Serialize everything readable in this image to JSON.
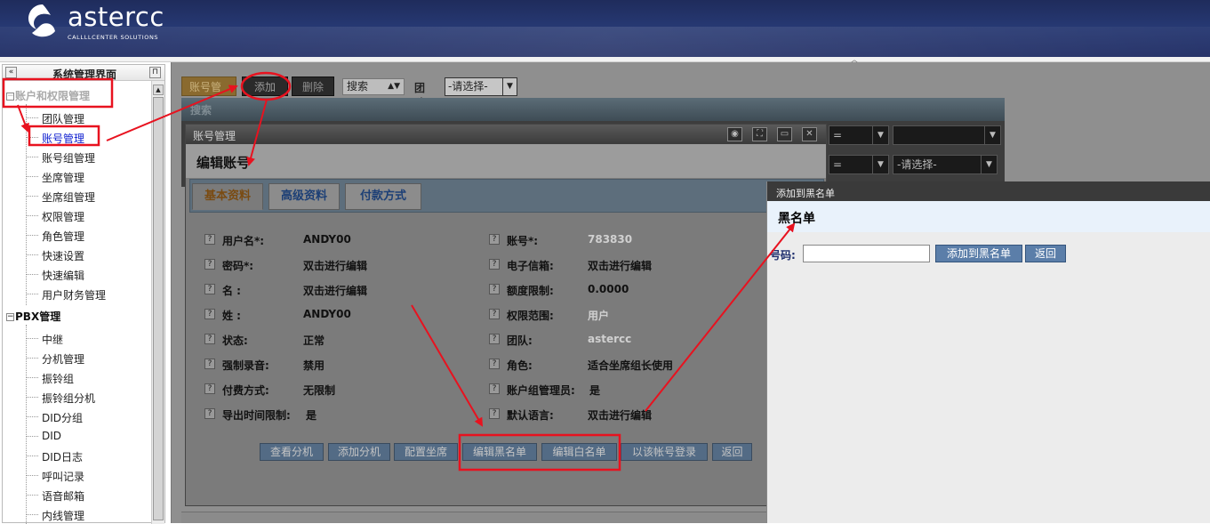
{
  "app": {
    "logo_text": "astercc",
    "logo_sub": "CALLLLCENTER SOLUTIONS"
  },
  "sidebar": {
    "title": "系统管理界面",
    "groups": [
      {
        "label": "账户和权限管理",
        "items": [
          "团队管理",
          "账号管理",
          "账号组管理",
          "坐席管理",
          "坐席组管理",
          "权限管理",
          "角色管理",
          "快速设置",
          "快速编辑",
          "用户财务管理"
        ]
      },
      {
        "label": "PBX管理",
        "items": [
          "中继",
          "分机管理",
          "振铃组",
          "振铃组分机",
          "DID分组",
          "DID",
          "DID日志",
          "呼叫记录",
          "语音邮箱",
          "内线管理"
        ]
      }
    ]
  },
  "toolbar": {
    "tab_account": "账号管理",
    "add": "添加",
    "delete": "删除",
    "search_select": "搜索",
    "team_label": "团队:",
    "team_select": "-请选择-"
  },
  "search_panel": {
    "title": "搜索",
    "op1": "=",
    "op2": "=",
    "select": "-请选择-"
  },
  "edit_dialog": {
    "window_title": "账号管理",
    "heading": "编辑账号",
    "tabs": [
      "基本资料",
      "高级资料",
      "付款方式"
    ],
    "left_fields": [
      {
        "label": "用户名*:",
        "value": "ANDY00"
      },
      {
        "label": "密码*:",
        "value": "双击进行编辑"
      },
      {
        "label": "名 :",
        "value": "双击进行编辑"
      },
      {
        "label": "姓 :",
        "value": "ANDY00"
      },
      {
        "label": "状态:",
        "value": "正常"
      },
      {
        "label": "强制录音:",
        "value": "禁用"
      },
      {
        "label": "付费方式:",
        "value": "无限制"
      },
      {
        "label": "导出时间限制:",
        "value": "是"
      }
    ],
    "right_fields": [
      {
        "label": "账号*:",
        "value": "783830"
      },
      {
        "label": "电子信箱:",
        "value": "双击进行编辑"
      },
      {
        "label": "额度限制:",
        "value": "0.0000"
      },
      {
        "label": "权限范围:",
        "value": "用户"
      },
      {
        "label": "团队:",
        "value": "astercc"
      },
      {
        "label": "角色:",
        "value": "适合坐席组长使用"
      },
      {
        "label": "账户组管理员:",
        "value": "是"
      },
      {
        "label": "默认语言:",
        "value": "双击进行编辑"
      }
    ],
    "actions": [
      "查看分机",
      "添加分机",
      "配置坐席",
      "编辑黑名单",
      "编辑白名单",
      "以该帐号登录",
      "返回"
    ]
  },
  "blacklist": {
    "window_title": "添加到黑名单",
    "heading": "黑名单",
    "number_label": "号码:",
    "number_value": "",
    "add_button": "添加到黑名单",
    "back_button": "返回"
  },
  "colors": {
    "annotation": "#e8121f",
    "header": "#243470",
    "button_blue": "#5b7ea9"
  }
}
